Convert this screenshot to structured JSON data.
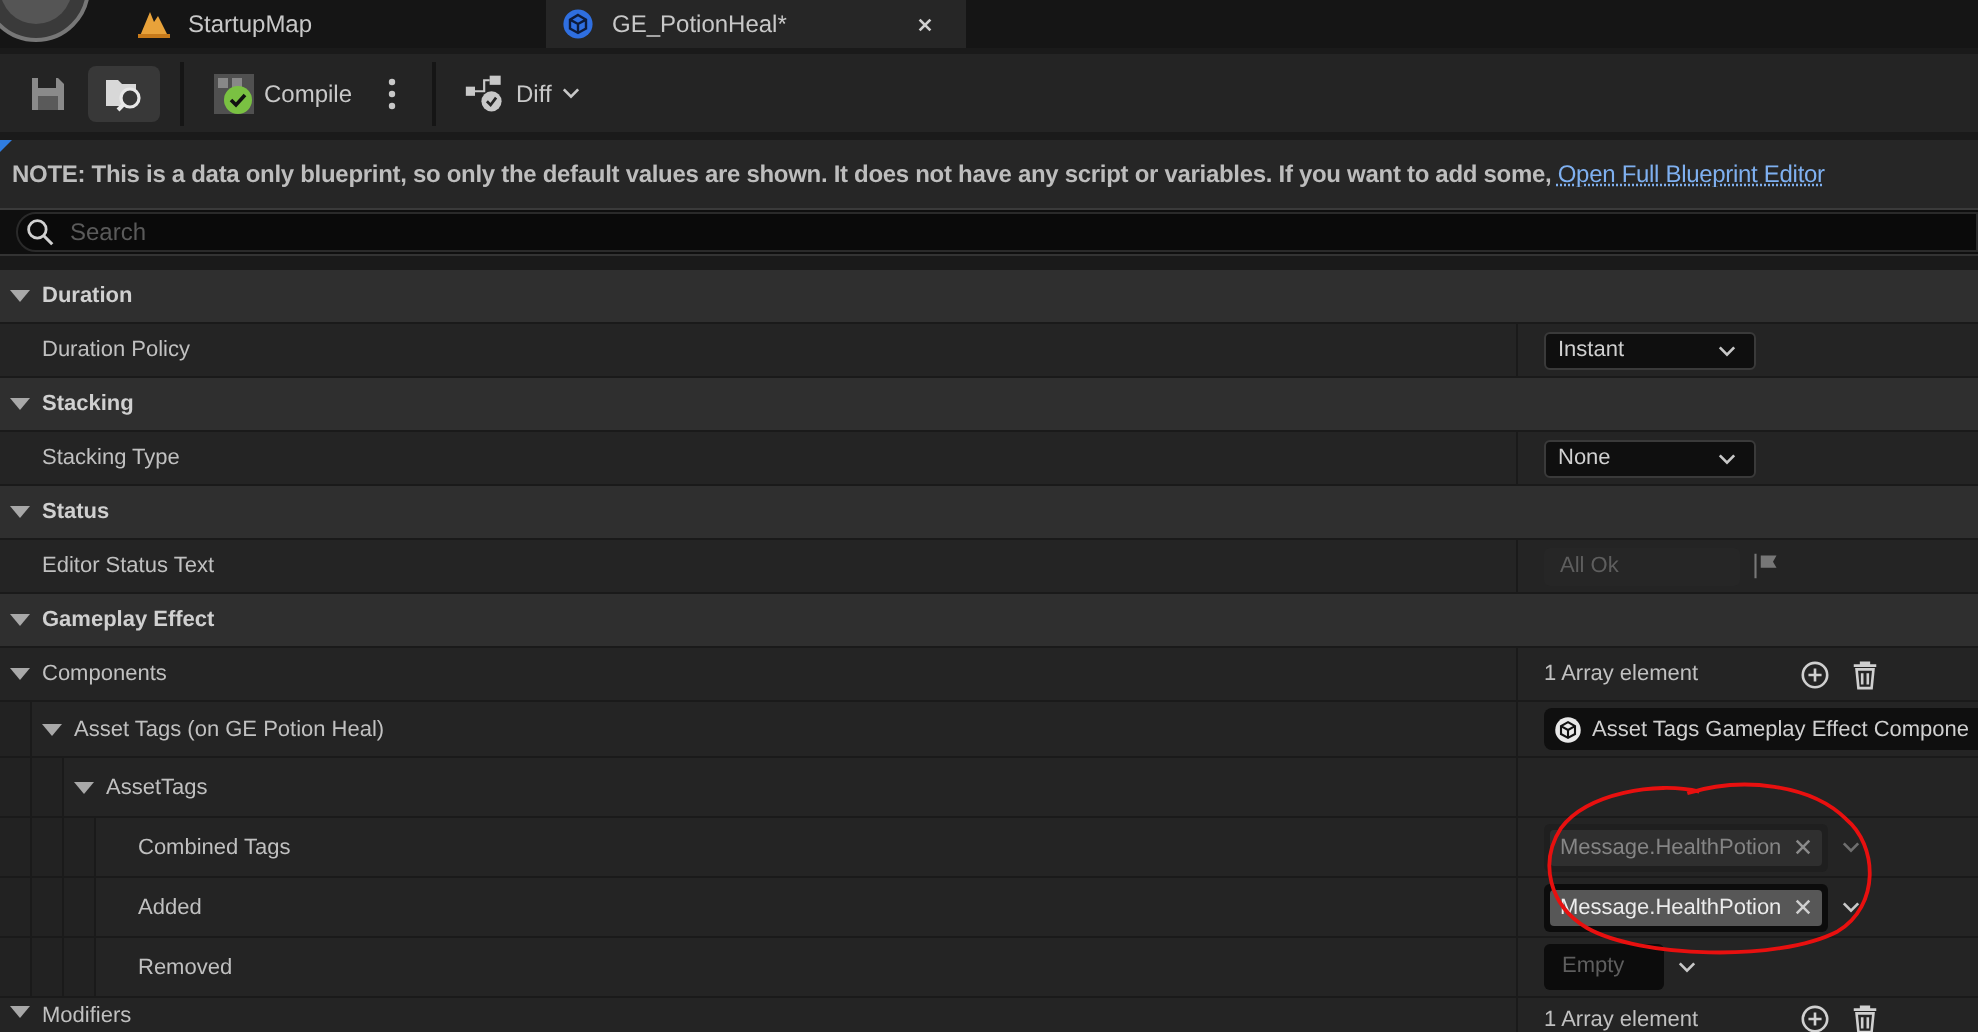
{
  "tabs": [
    {
      "label": "StartupMap",
      "selected": false
    },
    {
      "label": "GE_PotionHeal*",
      "selected": true
    }
  ],
  "toolbar": {
    "items": [
      {
        "kind": "save"
      },
      {
        "kind": "browse",
        "active": true
      },
      {
        "kind": "separator"
      },
      {
        "kind": "compile",
        "label": "Compile"
      },
      {
        "kind": "more"
      },
      {
        "kind": "separator"
      },
      {
        "kind": "diff",
        "label": "Diff"
      }
    ]
  },
  "notice": {
    "text": "NOTE: This is a data only blueprint, so only the default values are shown.  It does not have any script or variables.  If you want to add some, ",
    "link": "Open Full Blueprint Editor"
  },
  "search": {
    "placeholder": "Search"
  },
  "details": [
    {
      "label": "Duration",
      "expanded": true,
      "children": [
        {
          "label": "Duration Policy",
          "value": {
            "kind": "dropdown",
            "text": "Instant"
          }
        }
      ]
    },
    {
      "label": "Stacking",
      "expanded": true,
      "children": [
        {
          "label": "Stacking Type",
          "value": {
            "kind": "dropdown",
            "text": "None"
          }
        }
      ]
    },
    {
      "label": "Status",
      "expanded": true,
      "children": [
        {
          "label": "Editor Status Text",
          "value": {
            "kind": "text",
            "text": "All Ok",
            "disabled": true
          }
        }
      ]
    },
    {
      "label": "Gameplay Effect",
      "expanded": true,
      "children": [
        {
          "label": "Components",
          "expanded": true,
          "value": {
            "kind": "array",
            "text": "1 Array element"
          },
          "children": [
            {
              "label": "Asset Tags (on GE Potion Heal)",
              "expanded": true,
              "value": {
                "kind": "object",
                "text": "Asset Tags Gameplay Effect Compone"
              },
              "children": [
                {
                  "label": "AssetTags",
                  "expanded": true,
                  "children": [
                    {
                      "label": "Combined Tags",
                      "value": {
                        "kind": "tags",
                        "disabled": true,
                        "tags": [
                          "Message.HealthPotion"
                        ]
                      }
                    },
                    {
                      "label": "Added",
                      "value": {
                        "kind": "tags",
                        "disabled": false,
                        "tags": [
                          "Message.HealthPotion"
                        ]
                      }
                    },
                    {
                      "label": "Removed",
                      "value": {
                        "kind": "empty",
                        "text": "Empty"
                      }
                    }
                  ]
                }
              ]
            }
          ]
        },
        {
          "label": "Modifiers",
          "expanded": true,
          "value": {
            "kind": "array",
            "text": "1 Array element"
          }
        }
      ]
    }
  ]
}
